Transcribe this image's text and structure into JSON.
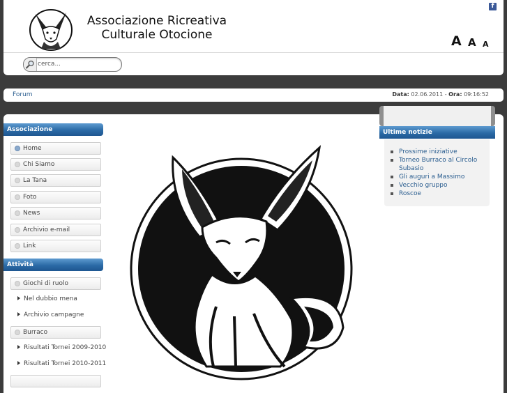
{
  "header": {
    "title_line1": "Associazione Ricreativa",
    "title_line2": "Culturale Otocione",
    "font_sizes": [
      "A",
      "A",
      "A"
    ],
    "social_icon": "facebook-icon"
  },
  "search": {
    "placeholder": "cerca..."
  },
  "breadcrumb": {
    "item": "Forum",
    "date_label": "Data:",
    "date_value": "02.06.2011",
    "separator": " - ",
    "time_label": "Ora:",
    "time_value": "09:16:52"
  },
  "sidebar": {
    "heading_associazione": "Associazione",
    "items": [
      {
        "label": "Home"
      },
      {
        "label": "Chi Siamo"
      },
      {
        "label": "La Tana"
      },
      {
        "label": "Foto"
      },
      {
        "label": "News"
      },
      {
        "label": "Archivio e-mail"
      },
      {
        "label": "Link"
      }
    ],
    "heading_attivita": "Attività",
    "attivita": [
      {
        "label": "Giochi di ruolo"
      },
      {
        "label": "Nel dubbio mena"
      },
      {
        "label": "Archivio campagne"
      },
      {
        "label": "Burraco"
      },
      {
        "label": "Risultati Tornei 2009-2010"
      },
      {
        "label": "Risultati Tornei 2010-2011"
      }
    ]
  },
  "news": {
    "heading": "Ultime notizie",
    "items": [
      {
        "label": "Prossime iniziative"
      },
      {
        "label": "Torneo Burraco al Circolo Subasio"
      },
      {
        "label": "Gli auguri a Massimo"
      },
      {
        "label": "Vecchio gruppo"
      },
      {
        "label": "Roscoe"
      }
    ]
  },
  "colors": {
    "module_header": "#2b6aa6",
    "link": "#2a5d8f",
    "page_bg": "#3c3c3c"
  }
}
